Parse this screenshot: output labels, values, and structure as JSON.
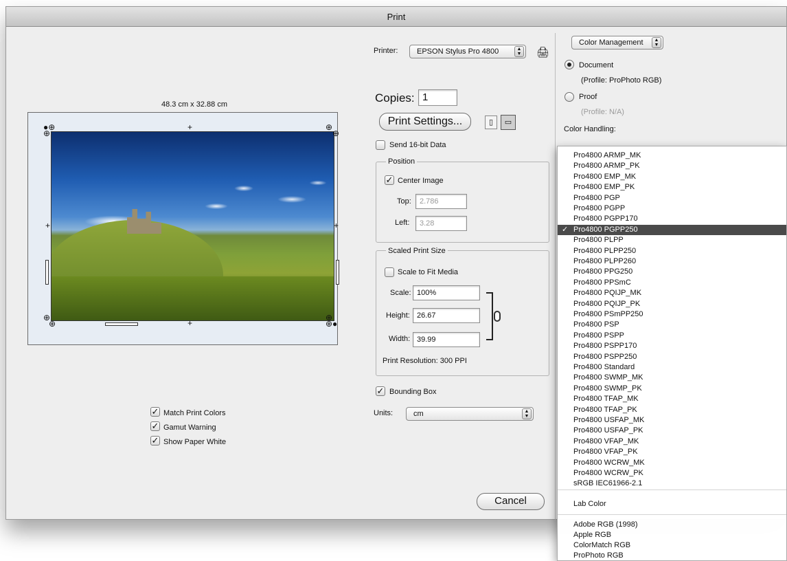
{
  "window": {
    "title": "Print"
  },
  "printer": {
    "label": "Printer:",
    "value": "EPSON Stylus Pro 4800"
  },
  "copies": {
    "label": "Copies:",
    "value": "1"
  },
  "print_settings_button": "Print Settings...",
  "send_16bit": {
    "label": "Send 16-bit Data",
    "checked": false
  },
  "preview": {
    "size_label": "48.3 cm x 32.88 cm"
  },
  "position": {
    "title": "Position",
    "center_image": {
      "label": "Center Image",
      "checked": true
    },
    "top_label": "Top:",
    "top_value": "2.786",
    "left_label": "Left:",
    "left_value": "3.28"
  },
  "scaled": {
    "title": "Scaled Print Size",
    "scale_to_fit": {
      "label": "Scale to Fit Media",
      "checked": false
    },
    "scale_label": "Scale:",
    "scale_value": "100%",
    "height_label": "Height:",
    "height_value": "26.67",
    "width_label": "Width:",
    "width_value": "39.99",
    "resolution": "Print Resolution: 300 PPI"
  },
  "bounding_box": {
    "label": "Bounding Box",
    "checked": true
  },
  "units": {
    "label": "Units:",
    "value": "cm"
  },
  "options": [
    {
      "label": "Match Print Colors",
      "checked": true
    },
    {
      "label": "Gamut Warning",
      "checked": true
    },
    {
      "label": "Show Paper White",
      "checked": true
    }
  ],
  "cancel_button": "Cancel",
  "color_mgmt": {
    "popup": "Color Management",
    "document_label": "Document",
    "document_profile": "(Profile: ProPhoto RGB)",
    "proof_label": "Proof",
    "proof_profile": "(Profile: N/A)",
    "handling_label": "Color Handling:"
  },
  "profile_menu": {
    "selected_index": 7,
    "items": [
      "Pro4800 ARMP_MK",
      "Pro4800 ARMP_PK",
      "Pro4800 EMP_MK",
      "Pro4800 EMP_PK",
      "Pro4800 PGP",
      "Pro4800 PGPP",
      "Pro4800 PGPP170",
      "Pro4800 PGPP250",
      "Pro4800 PLPP",
      "Pro4800 PLPP250",
      "Pro4800 PLPP260",
      "Pro4800 PPG250",
      "Pro4800 PPSmC",
      "Pro4800 PQIJP_MK",
      "Pro4800 PQIJP_PK",
      "Pro4800 PSmPP250",
      "Pro4800 PSP",
      "Pro4800 PSPP",
      "Pro4800 PSPP170",
      "Pro4800 PSPP250",
      "Pro4800 Standard",
      "Pro4800 SWMP_MK",
      "Pro4800 SWMP_PK",
      "Pro4800 TFAP_MK",
      "Pro4800 TFAP_PK",
      "Pro4800 USFAP_MK",
      "Pro4800 USFAP_PK",
      "Pro4800 VFAP_MK",
      "Pro4800 VFAP_PK",
      "Pro4800 WCRW_MK",
      "Pro4800 WCRW_PK",
      "sRGB IEC61966-2.1"
    ],
    "lab_item": "Lab Color",
    "rgb_items": [
      "Adobe RGB (1998)",
      "Apple RGB",
      "ColorMatch RGB",
      "ProPhoto RGB"
    ]
  }
}
